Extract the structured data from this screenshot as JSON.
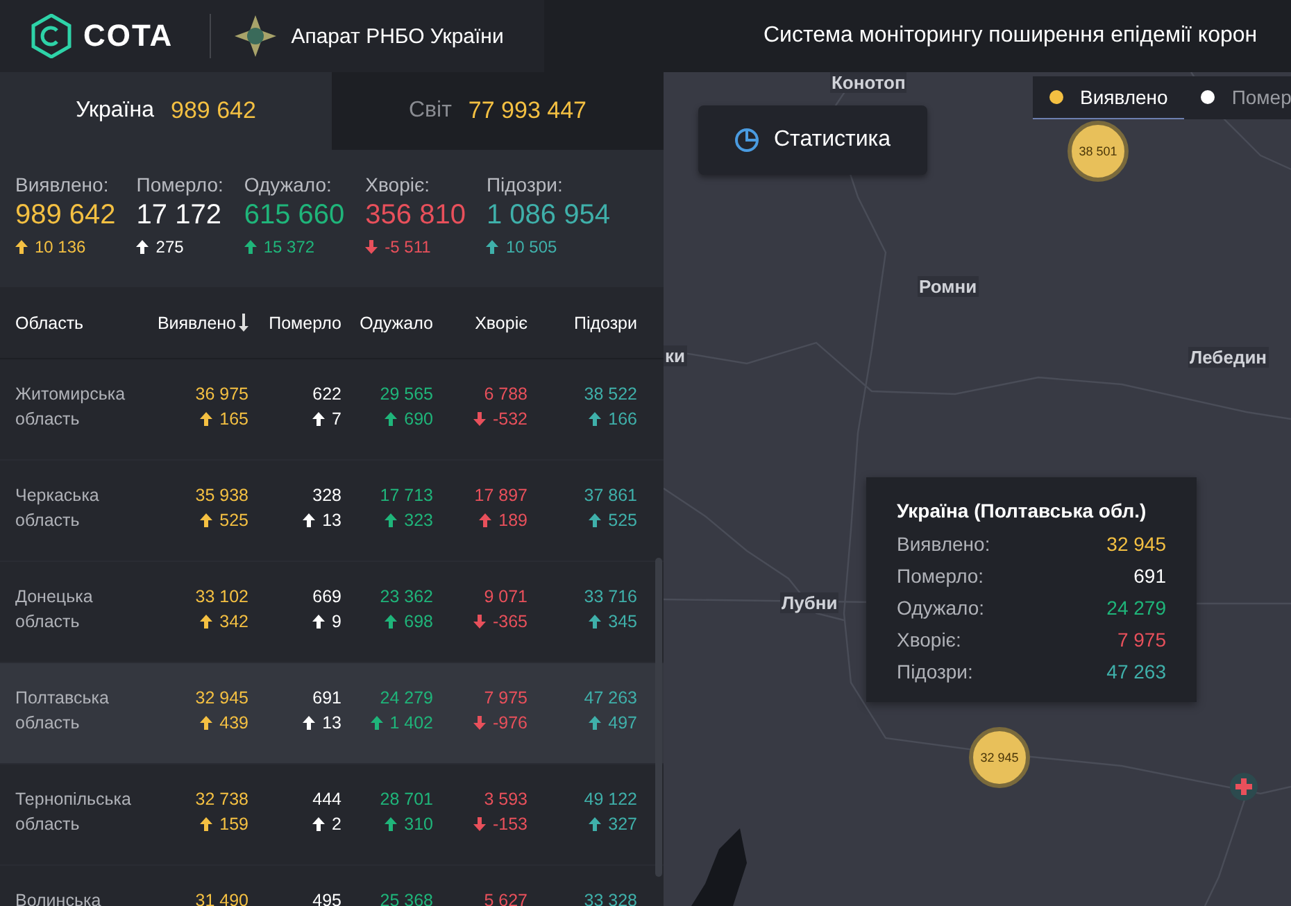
{
  "header": {
    "brand": "COTA",
    "org": "Апарат РНБО України",
    "title": "Система моніторингу поширення епідемії корон"
  },
  "scope_tabs": [
    {
      "label": "Україна",
      "value": "989 642",
      "selected": true
    },
    {
      "label": "Світ",
      "value": "77 993 447",
      "selected": false
    }
  ],
  "summary": [
    {
      "kind": "confirmed",
      "label": "Виявлено:",
      "value": "989 642",
      "delta": "10 136",
      "rising": true
    },
    {
      "kind": "deaths",
      "label": "Померло:",
      "value": "17 172",
      "delta": "275",
      "rising": true
    },
    {
      "kind": "recovered",
      "label": "Одужало:",
      "value": "615 660",
      "delta": "15 372",
      "rising": true
    },
    {
      "kind": "active",
      "label": "Хворіє:",
      "value": "356 810",
      "delta": "-5 511",
      "rising": false
    },
    {
      "kind": "suspected",
      "label": "Підозри:",
      "value": "1 086 954",
      "delta": "10 505",
      "rising": true
    }
  ],
  "table": {
    "columns": [
      {
        "label": "Область",
        "kind": "region",
        "sorted": false
      },
      {
        "label": "Виявлено",
        "kind": "confirmed",
        "sorted": true
      },
      {
        "label": "Померло",
        "kind": "deaths",
        "sorted": false
      },
      {
        "label": "Одужало",
        "kind": "recovered",
        "sorted": false
      },
      {
        "label": "Хворіє",
        "kind": "active",
        "sorted": false
      },
      {
        "label": "Підозри",
        "kind": "suspected",
        "sorted": false
      }
    ],
    "rows": [
      {
        "selected": false,
        "cells": [
          {
            "value": "Житомирська область"
          },
          {
            "value": "36 975",
            "delta": "165",
            "rising": true
          },
          {
            "value": "622",
            "delta": "7",
            "rising": true
          },
          {
            "value": "29 565",
            "delta": "690",
            "rising": true
          },
          {
            "value": "6 788",
            "delta": "-532",
            "rising": false
          },
          {
            "value": "38 522",
            "delta": "166",
            "rising": true
          }
        ]
      },
      {
        "selected": false,
        "cells": [
          {
            "value": "Черкаська область"
          },
          {
            "value": "35 938",
            "delta": "525",
            "rising": true
          },
          {
            "value": "328",
            "delta": "13",
            "rising": true
          },
          {
            "value": "17 713",
            "delta": "323",
            "rising": true
          },
          {
            "value": "17 897",
            "delta": "189",
            "rising": true
          },
          {
            "value": "37 861",
            "delta": "525",
            "rising": true
          }
        ]
      },
      {
        "selected": false,
        "cells": [
          {
            "value": "Донецька область"
          },
          {
            "value": "33 102",
            "delta": "342",
            "rising": true
          },
          {
            "value": "669",
            "delta": "9",
            "rising": true
          },
          {
            "value": "23 362",
            "delta": "698",
            "rising": true
          },
          {
            "value": "9 071",
            "delta": "-365",
            "rising": false
          },
          {
            "value": "33 716",
            "delta": "345",
            "rising": true
          }
        ]
      },
      {
        "selected": true,
        "cells": [
          {
            "value": "Полтавська область"
          },
          {
            "value": "32 945",
            "delta": "439",
            "rising": true
          },
          {
            "value": "691",
            "delta": "13",
            "rising": true
          },
          {
            "value": "24 279",
            "delta": "1 402",
            "rising": true
          },
          {
            "value": "7 975",
            "delta": "-976",
            "rising": false
          },
          {
            "value": "47 263",
            "delta": "497",
            "rising": true
          }
        ]
      },
      {
        "selected": false,
        "cells": [
          {
            "value": "Тернопільська область"
          },
          {
            "value": "32 738",
            "delta": "159",
            "rising": true
          },
          {
            "value": "444",
            "delta": "2",
            "rising": true
          },
          {
            "value": "28 701",
            "delta": "310",
            "rising": true
          },
          {
            "value": "3 593",
            "delta": "-153",
            "rising": false
          },
          {
            "value": "49 122",
            "delta": "327",
            "rising": true
          }
        ]
      },
      {
        "selected": false,
        "cells": [
          {
            "value": "Волинська"
          },
          {
            "value": "31 490"
          },
          {
            "value": "495"
          },
          {
            "value": "25 368"
          },
          {
            "value": "5 627"
          },
          {
            "value": "33 328"
          }
        ]
      }
    ]
  },
  "map": {
    "stats_button": "Статистика",
    "legend": [
      {
        "label": "Виявлено",
        "kind": "confirmed",
        "selected": true
      },
      {
        "label": "Помер",
        "kind": "deaths",
        "selected": false
      }
    ],
    "places": [
      "Конотоп",
      "Ромни",
      "ки",
      "Лебедин",
      "Лубни"
    ],
    "clusters": [
      "38 501",
      "32 945"
    ],
    "tooltip": {
      "title": "Україна (Полтавська обл.)",
      "rows": [
        {
          "kind": "confirmed",
          "label": "Виявлено:",
          "value": "32 945"
        },
        {
          "kind": "deaths",
          "label": "Померло:",
          "value": "691"
        },
        {
          "kind": "recovered",
          "label": "Одужало:",
          "value": "24 279"
        },
        {
          "kind": "active",
          "label": "Хворіє:",
          "value": "7 975"
        },
        {
          "kind": "suspected",
          "label": "Підозри:",
          "value": "47 263"
        }
      ]
    }
  }
}
